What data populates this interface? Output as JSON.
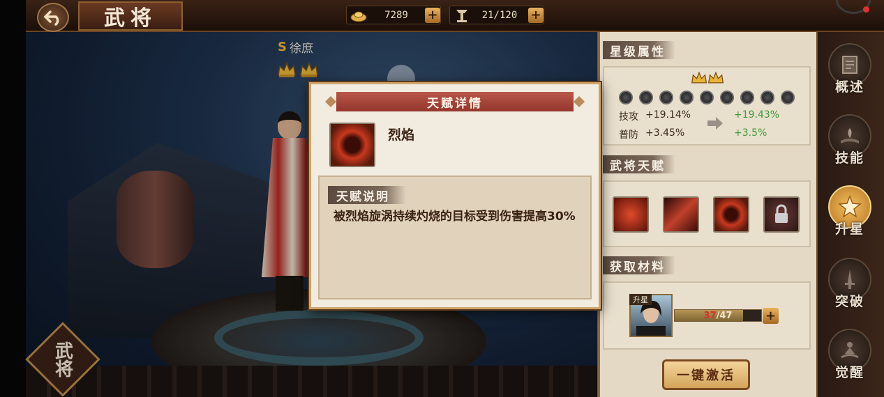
{
  "top_bar": {
    "page_title": "武将",
    "gold": {
      "icon": "gold-ingot-icon",
      "value": "7289"
    },
    "stamina": {
      "icon": "stamina-flag-icon",
      "value": "21/120"
    }
  },
  "hero": {
    "name": "徐庶",
    "rank_icon": "s-rank-icon",
    "crowns": 2
  },
  "side_tag": "武将",
  "dialog": {
    "title": "天赋详情",
    "talent_name": "烈焰",
    "desc_title": "天赋说明",
    "description": "被烈焰旋涡持续灼烧的目标受到伤害提高30%"
  },
  "panel": {
    "star_section_title": "星级属性",
    "star_crowns": 2,
    "star_dots": 9,
    "stats": [
      {
        "name": "技攻",
        "current": "+19.14%",
        "next": "+19.43%"
      },
      {
        "name": "普防",
        "current": "+3.45%",
        "next": "+3.5%"
      }
    ],
    "talent_section_title": "武将天赋",
    "talents": [
      "flame-swirl-talent-icon",
      "blade-talent-icon",
      "flame-talent-icon",
      "locked-talent-icon"
    ],
    "material_section_title": "获取材料",
    "material": {
      "tag": "升星",
      "current": "37",
      "max": "/47",
      "fraction": 0.787
    },
    "activate_label": "一键激活"
  },
  "nav": [
    {
      "label": "概述",
      "icon": "book-icon",
      "active": false
    },
    {
      "label": "技能",
      "icon": "skill-book-icon",
      "active": false
    },
    {
      "label": "升星",
      "icon": "star-icon",
      "active": true
    },
    {
      "label": "突破",
      "icon": "sword-icon",
      "active": false
    },
    {
      "label": "觉醒",
      "icon": "meditation-icon",
      "active": false
    }
  ],
  "colors": {
    "accent_gold": "#e8b25a",
    "stat_up_green": "#3e9a3a",
    "dialog_title_red": "#93362c"
  }
}
